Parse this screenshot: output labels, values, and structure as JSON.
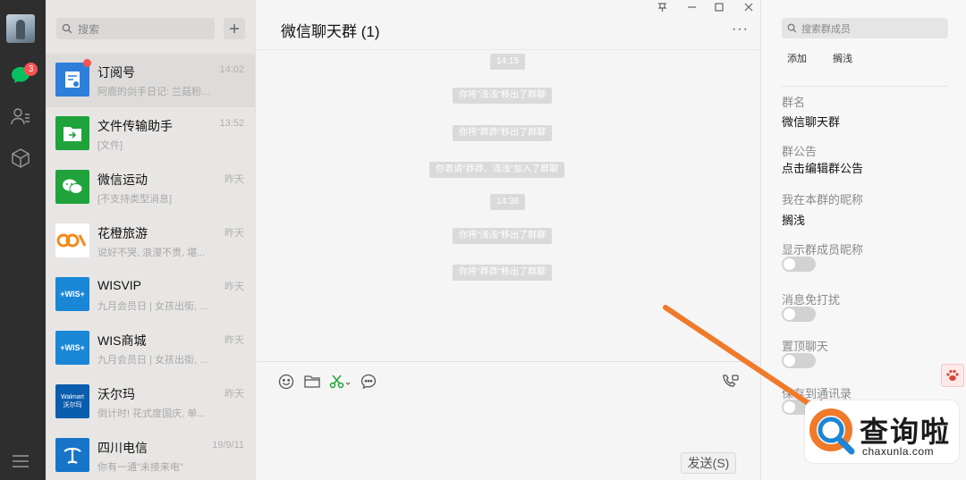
{
  "rail": {
    "unread_count": "3"
  },
  "list": {
    "search_placeholder": "搜索",
    "conversations": [
      {
        "name": "订阅号",
        "time": "14:02",
        "preview": "阿鹿的剑手日记: 兰菇粉..."
      },
      {
        "name": "文件传输助手",
        "time": "13:52",
        "preview": "[文件]"
      },
      {
        "name": "微信运动",
        "time": "昨天",
        "preview": "[不支持类型消息]"
      },
      {
        "name": "花橙旅游",
        "time": "昨天",
        "preview": "说好不哭, 浪漫不贵, 堪..."
      },
      {
        "name": "WISVIP",
        "time": "昨天",
        "preview": "九月会员日 | 女孩出街, ..."
      },
      {
        "name": "WIS商城",
        "time": "昨天",
        "preview": "九月会员日 | 女孩出街, ..."
      },
      {
        "name": "沃尔玛",
        "time": "昨天",
        "preview": "倒计时! 花式度国庆, 单..."
      },
      {
        "name": "四川电信",
        "time": "19/9/11",
        "preview": "你有一通\"未接来电\""
      }
    ],
    "icon_text": {
      "wis": "+WIS+",
      "walmart": "Walmart",
      "walmart_sub": "沃尔玛"
    }
  },
  "chat": {
    "title": "微信聊天群 (1)",
    "more": "···",
    "messages": [
      {
        "kind": "time",
        "text": "14:15"
      },
      {
        "kind": "system",
        "text": "你将\"浅浅\"移出了群聊"
      },
      {
        "kind": "system",
        "text": "你将\"莽莽\"移出了群聊"
      },
      {
        "kind": "system",
        "text": "你邀请\"莽莽、浅浅\"加入了群聊"
      },
      {
        "kind": "time",
        "text": "14:36"
      },
      {
        "kind": "system",
        "text": "你将\"浅浅\"移出了群聊"
      },
      {
        "kind": "system",
        "text": "你将\"莽莽\"移出了群聊"
      }
    ],
    "send_label": "发送(S)"
  },
  "panel": {
    "search_placeholder": "搜索群成员",
    "add_label": "添加",
    "member_name": "搁浅",
    "group_name_label": "群名",
    "group_name_value": "微信聊天群",
    "notice_label": "群公告",
    "notice_value": "点击编辑群公告",
    "nickname_label": "我在本群的昵称",
    "nickname_value": "搁浅",
    "show_nick_label": "显示群成员昵称",
    "mute_label": "消息免打扰",
    "pin_label": "置顶聊天",
    "contacts_label": "保存到通讯录"
  },
  "watermark": {
    "title": "查询啦",
    "url": "chaxunla.com"
  },
  "colors": {
    "accent_green": "#07c160",
    "badge_red": "#fa5151",
    "arrow_orange": "#f07a2a"
  }
}
